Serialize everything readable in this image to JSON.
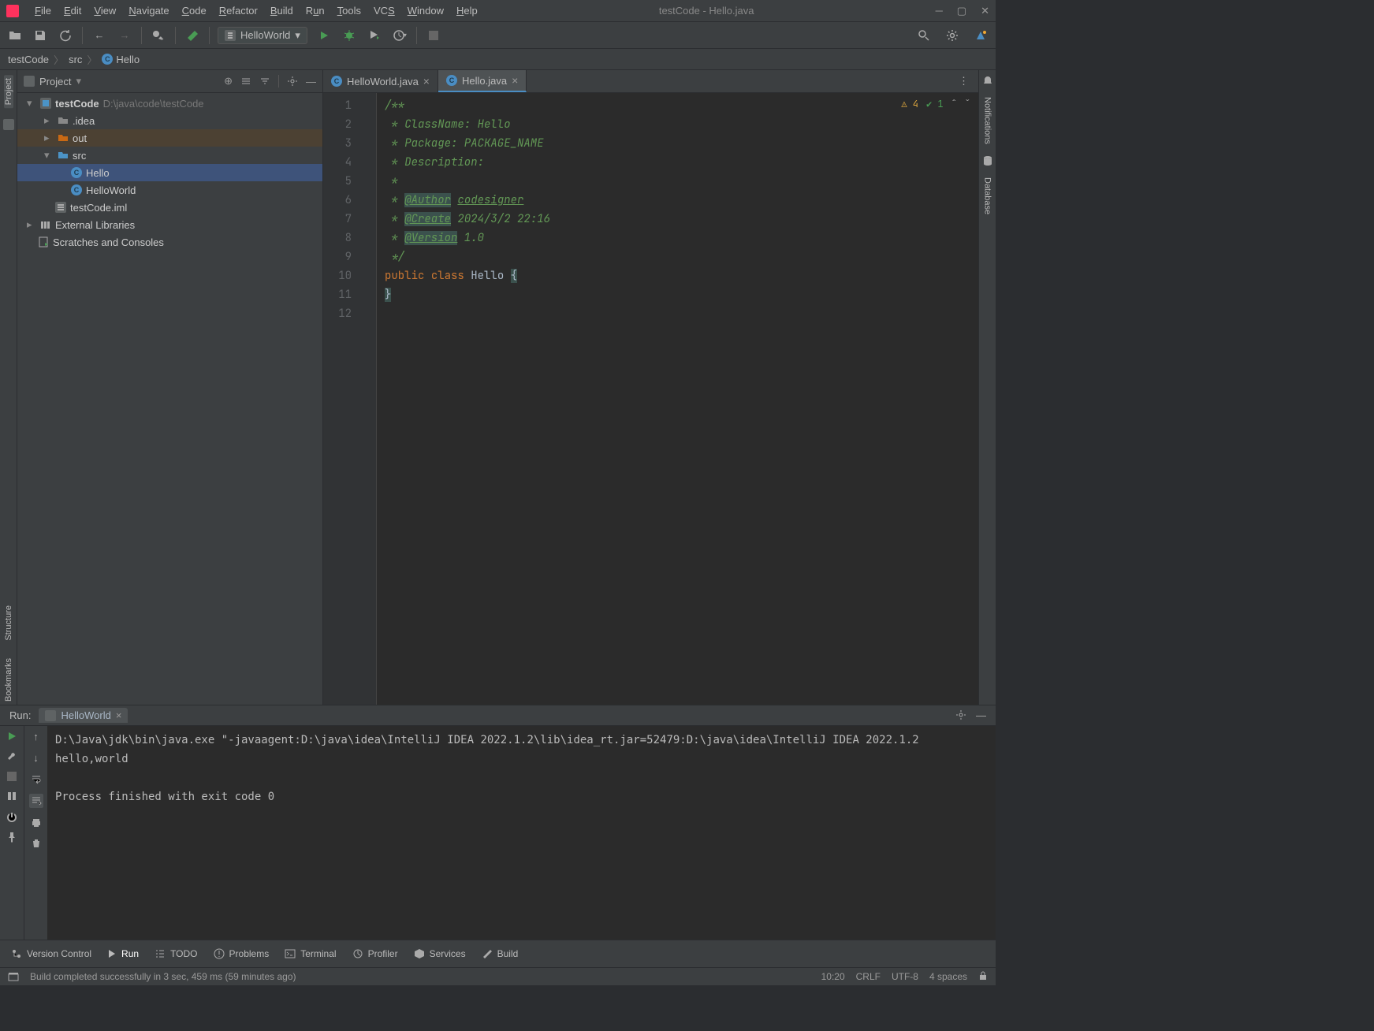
{
  "window": {
    "title": "testCode - Hello.java"
  },
  "menus": [
    "File",
    "Edit",
    "View",
    "Navigate",
    "Code",
    "Refactor",
    "Build",
    "Run",
    "Tools",
    "VCS",
    "Window",
    "Help"
  ],
  "runconfig": {
    "name": "HelloWorld"
  },
  "breadcrumb": {
    "root": "testCode",
    "folder": "src",
    "class": "Hello"
  },
  "rails": {
    "project": "Project",
    "structure": "Structure",
    "bookmarks": "Bookmarks",
    "notifications": "Notifications",
    "database": "Database"
  },
  "projectPanel": {
    "title": "Project"
  },
  "tree": {
    "root": {
      "name": "testCode",
      "path": "D:\\java\\code\\testCode"
    },
    "idea": ".idea",
    "out": "out",
    "src": "src",
    "hello": "Hello",
    "helloworld": "HelloWorld",
    "iml": "testCode.iml",
    "ext": "External Libraries",
    "scratch": "Scratches and Consoles"
  },
  "tabs": {
    "t1": "HelloWorld.java",
    "t2": "Hello.java"
  },
  "code": {
    "l1": "/**",
    "l2": " * ClassName: Hello",
    "l3": " * Package: PACKAGE_NAME",
    "l4": " * Description:",
    "l5": " *",
    "l6a": " * ",
    "l6tag": "@Author",
    "l6b": " ",
    "l6u": "codesigner",
    "l7a": " * ",
    "l7tag": "@Create",
    "l7b": " 2024/3/2 22:16",
    "l8a": " * ",
    "l8tag": "@Version",
    "l8b": " 1.0",
    "l9": " */",
    "l10a": "public",
    "l10b": " ",
    "l10c": "class",
    "l10d": " ",
    "l10e": "Hello",
    "l10f": " ",
    "l10g": "{",
    "l11": "}",
    "lineNums": {
      "1": "1",
      "2": "2",
      "3": "3",
      "4": "4",
      "5": "5",
      "6": "6",
      "7": "7",
      "8": "8",
      "9": "9",
      "10": "10",
      "11": "11",
      "12": "12"
    }
  },
  "editorStatus": {
    "warnCount": "4",
    "okCount": "1"
  },
  "runPanel": {
    "label": "Run:",
    "tab": "HelloWorld"
  },
  "console": {
    "line1": "D:\\Java\\jdk\\bin\\java.exe \"-javaagent:D:\\java\\idea\\IntelliJ IDEA 2022.1.2\\lib\\idea_rt.jar=52479:D:\\java\\idea\\IntelliJ IDEA 2022.1.2",
    "line2": "hello,world",
    "line3": "",
    "line4": "Process finished with exit code 0"
  },
  "bottomTabs": {
    "vcs": "Version Control",
    "run": "Run",
    "todo": "TODO",
    "problems": "Problems",
    "terminal": "Terminal",
    "profiler": "Profiler",
    "services": "Services",
    "build": "Build"
  },
  "status": {
    "msg": "Build completed successfully in 3 sec, 459 ms (59 minutes ago)",
    "pos": "10:20",
    "eol": "CRLF",
    "enc": "UTF-8",
    "indent": "4 spaces"
  }
}
